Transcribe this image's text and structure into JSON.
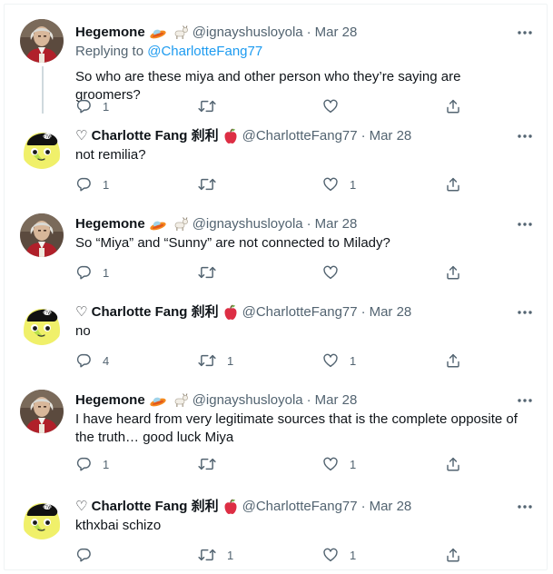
{
  "replying_to": {
    "prefix": "Replying to ",
    "mention": "@CharlotteFang77"
  },
  "tweets": [
    {
      "author": "hegemone",
      "display_name": "Hegemone",
      "handle": "@ignayshusloyola",
      "separator": "·",
      "date": "Mar 28",
      "text": "So who are these miya and other person who they’re saying are groomers?",
      "replies": "1",
      "retweets": "",
      "likes": ""
    },
    {
      "author": "charlotte",
      "display_name": "♡ Charlotte Fang 刹利",
      "handle": "@CharlotteFang77",
      "separator": "·",
      "date": "Mar 28",
      "text": "not remilia?",
      "replies": "1",
      "retweets": "",
      "likes": "1"
    },
    {
      "author": "hegemone",
      "display_name": "Hegemone",
      "handle": "@ignayshusloyola",
      "separator": "·",
      "date": "Mar 28",
      "text": "So “Miya” and “Sunny” are not connected to Milady?",
      "replies": "1",
      "retweets": "",
      "likes": ""
    },
    {
      "author": "charlotte",
      "display_name": "♡ Charlotte Fang 刹利",
      "handle": "@CharlotteFang77",
      "separator": "·",
      "date": "Mar 28",
      "text": "no",
      "replies": "4",
      "retweets": "1",
      "likes": "1"
    },
    {
      "author": "hegemone",
      "display_name": "Hegemone",
      "handle": "@ignayshusloyola",
      "separator": "·",
      "date": "Mar 28",
      "text": "I have heard from very legitimate sources that is the complete opposite of the truth… good luck Miya",
      "replies": "1",
      "retweets": "",
      "likes": "1"
    },
    {
      "author": "charlotte",
      "display_name": "♡ Charlotte Fang 刹利",
      "handle": "@CharlotteFang77",
      "separator": "·",
      "date": "Mar 28",
      "text": "kthxbai schizo",
      "replies": "",
      "retweets": "1",
      "likes": "1"
    }
  ],
  "colors": {
    "text": "#0f1419",
    "secondary": "#536471",
    "link": "#1d9bf0",
    "divider": "#eff3f4",
    "thread_line": "#cfd9de"
  },
  "icons": [
    "more-icon",
    "reply-icon",
    "retweet-icon",
    "like-icon",
    "share-icon",
    "ufo-emoji",
    "goat-emoji",
    "apple-emoji"
  ]
}
